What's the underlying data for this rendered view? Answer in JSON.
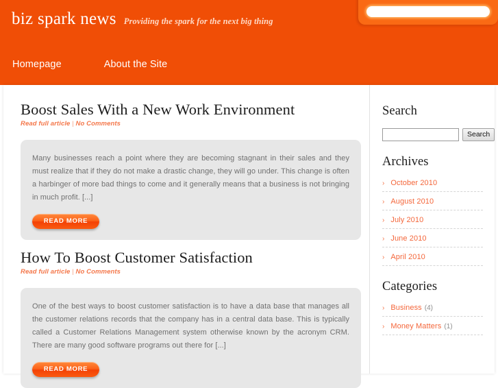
{
  "site": {
    "title": "biz spark news",
    "tagline": "Providing the spark for the next big thing",
    "header_search_placeholder": ""
  },
  "nav": {
    "items": [
      {
        "label": "Homepage"
      },
      {
        "label": "About the Site"
      }
    ]
  },
  "posts": [
    {
      "title": "Boost Sales With a New Work Environment",
      "meta_link": "Read full article",
      "meta_separator": "|",
      "meta_comments": "No Comments",
      "excerpt": "Many businesses reach a point where they are becoming stagnant in their sales and they must realize that if they do not make a drastic change, they will go under. This change is often a harbinger of more bad things to come and it generally means that a business is not bringing in much profit. [...]",
      "read_more_label": "READ MORE"
    },
    {
      "title": "How To Boost Customer Satisfaction",
      "meta_link": "Read full article",
      "meta_separator": "|",
      "meta_comments": "No Comments",
      "excerpt": "One of the best ways to boost customer satisfaction is to have a data base that manages all the customer relations records that the company has in a central data base. This is typically called a Customer Relations Management system otherwise known by the acronym CRM. There are many good software programs out there for [...]",
      "read_more_label": "READ MORE"
    }
  ],
  "sidebar": {
    "search": {
      "title": "Search",
      "input_value": "",
      "input_placeholder": "",
      "button_label": "Search"
    },
    "archives": {
      "title": "Archives",
      "items": [
        {
          "arrow": "›",
          "label": "October 2010"
        },
        {
          "arrow": "›",
          "label": "August 2010"
        },
        {
          "arrow": "›",
          "label": "July 2010"
        },
        {
          "arrow": "›",
          "label": "June 2010"
        },
        {
          "arrow": "›",
          "label": "April 2010"
        }
      ]
    },
    "categories": {
      "title": "Categories",
      "items": [
        {
          "arrow": "›",
          "label": "Business",
          "count": "(4)"
        },
        {
          "arrow": "›",
          "label": "Money Matters",
          "count": "(1)"
        }
      ]
    }
  },
  "colors": {
    "header_orange": "#f04e06",
    "panel_orange": "#fa6a14",
    "link_orange": "#f4663a",
    "excerpt_bg": "#e7e7e7"
  }
}
